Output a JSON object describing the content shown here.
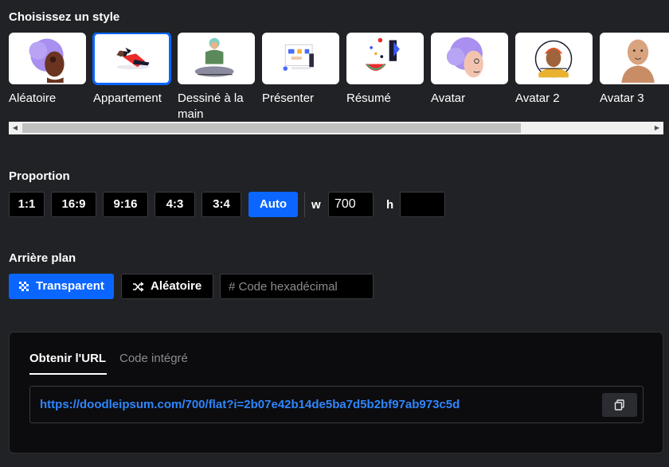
{
  "style_section": {
    "title": "Choisissez un style",
    "styles": [
      {
        "label": "Aléatoire",
        "icon": "random-style-illustration"
      },
      {
        "label": "Appartement",
        "icon": "flat-style-illustration",
        "selected": true
      },
      {
        "label": "Dessiné à la main",
        "icon": "hand-drawn-style-illustration"
      },
      {
        "label": "Présenter",
        "icon": "presenter-style-illustration"
      },
      {
        "label": "Résumé",
        "icon": "abstract-style-illustration"
      },
      {
        "label": "Avatar",
        "icon": "avatar-style-illustration"
      },
      {
        "label": "Avatar 2",
        "icon": "avatar2-style-illustration"
      },
      {
        "label": "Avatar 3",
        "icon": "avatar3-style-illustration"
      }
    ]
  },
  "proportion_section": {
    "title": "Proportion",
    "ratios": [
      "1:1",
      "16:9",
      "9:16",
      "4:3",
      "3:4",
      "Auto"
    ],
    "active_ratio": "Auto",
    "width_label": "w",
    "width_value": "700",
    "height_label": "h",
    "height_value": ""
  },
  "background_section": {
    "title": "Arrière plan",
    "transparent_label": "Transparent",
    "random_label": "Aléatoire",
    "hex_placeholder": "# Code hexadécimal"
  },
  "url_panel": {
    "tabs": [
      "Obtenir l'URL",
      "Code intégré"
    ],
    "active_tab": "Obtenir l'URL",
    "url": "https://doodleipsum.com/700/flat?i=2b07e42b14de5ba7d5b2bf97ab973c5d"
  },
  "colors": {
    "background": "#212226",
    "accent": "#0a66ff",
    "link": "#2f86ff"
  }
}
